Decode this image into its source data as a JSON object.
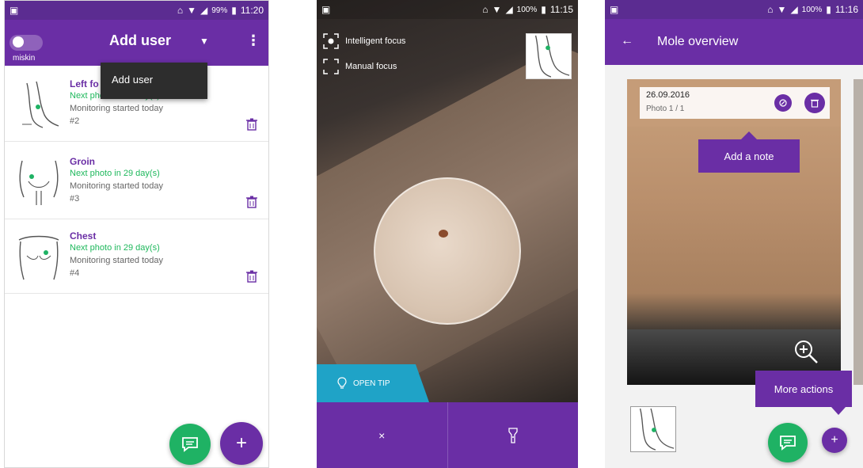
{
  "colors": {
    "primary": "#6a2ea5",
    "status_bar": "#5b2c91",
    "accent_green": "#1fb264",
    "tip_blue": "#1fa3c7"
  },
  "screen1": {
    "status": {
      "battery": "99%",
      "time": "11:20"
    },
    "header": {
      "logo_text": "miskin",
      "title": "Add user"
    },
    "dropdown": {
      "item": "Add user"
    },
    "entries": [
      {
        "name": "Left fo",
        "next": "Next photo in 29 day(s)",
        "monitoring": "Monitoring started today",
        "number": "#2"
      },
      {
        "name": "Groin",
        "next": "Next photo in 29 day(s)",
        "monitoring": "Monitoring started today",
        "number": "#3"
      },
      {
        "name": "Chest",
        "next": "Next photo in 29 day(s)",
        "monitoring": "Monitoring started today",
        "number": "#4"
      }
    ],
    "fab_add_symbol": "+"
  },
  "screen2": {
    "status": {
      "battery": "100%",
      "time": "11:15"
    },
    "focus": {
      "intelligent": "Intelligent focus",
      "manual": "Manual focus"
    },
    "open_tip": "OPEN TIP",
    "close_symbol": "×"
  },
  "screen3": {
    "status": {
      "battery": "100%",
      "time": "11:16"
    },
    "header": {
      "title": "Mole overview"
    },
    "photo": {
      "date": "26.09.2016",
      "count": "Photo 1 / 1"
    },
    "tooltips": {
      "note": "Add a note",
      "more": "More actions"
    },
    "fab_add_symbol": "+"
  }
}
